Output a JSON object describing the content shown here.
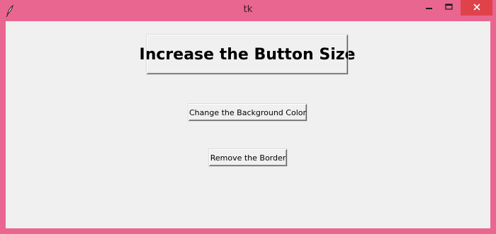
{
  "window": {
    "title": "tk",
    "frame_color": "#e8668f",
    "close_color": "#e0424a",
    "controls": {
      "minimize_icon": "minimize-icon",
      "maximize_icon": "maximize-icon",
      "close_icon": "close-icon"
    },
    "app_icon": "feather-icon"
  },
  "buttons": {
    "increase_size_label": "Increase the Button Size",
    "change_background_label": "Change the Background Color",
    "remove_border_label": "Remove the Border"
  }
}
